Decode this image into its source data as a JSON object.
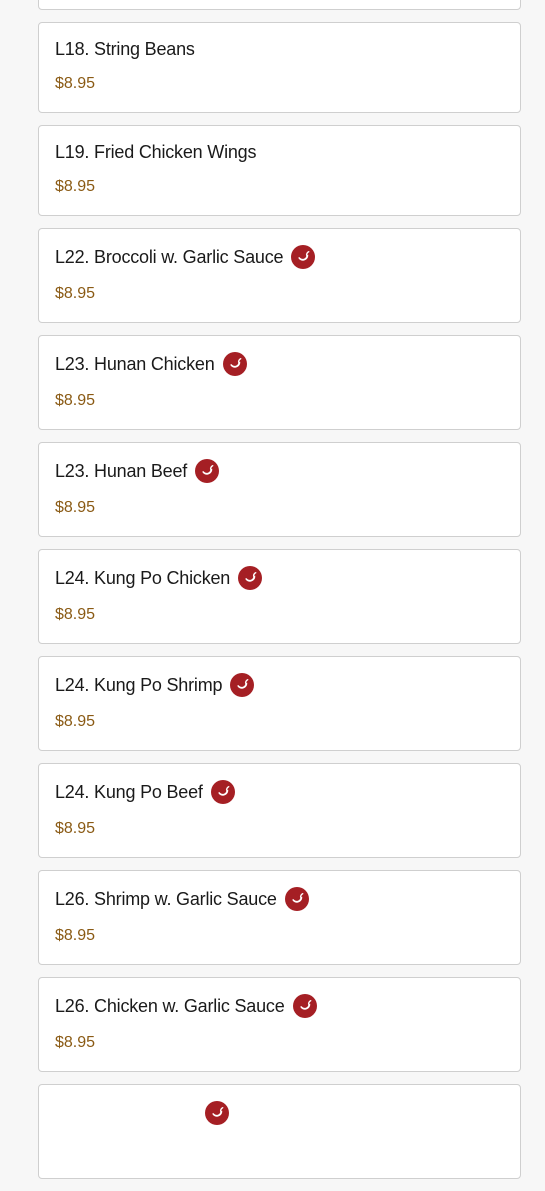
{
  "accent_color": "#a51f24",
  "price_color": "#8a5a14",
  "items": [
    {
      "name": "",
      "price": "",
      "spicy": false,
      "icon": ""
    },
    {
      "name": "L18. String Beans",
      "price": "$8.95",
      "spicy": false,
      "icon": ""
    },
    {
      "name": "L19. Fried Chicken Wings",
      "price": "$8.95",
      "spicy": false,
      "icon": ""
    },
    {
      "name": "L22. Broccoli w. Garlic Sauce",
      "price": "$8.95",
      "spicy": true,
      "icon": "chili-pepper-icon"
    },
    {
      "name": "L23. Hunan Chicken",
      "price": "$8.95",
      "spicy": true,
      "icon": "chili-pepper-icon"
    },
    {
      "name": "L23. Hunan Beef",
      "price": "$8.95",
      "spicy": true,
      "icon": "chili-pepper-icon"
    },
    {
      "name": "L24. Kung Po Chicken",
      "price": "$8.95",
      "spicy": true,
      "icon": "chili-pepper-icon"
    },
    {
      "name": "L24. Kung Po Shrimp",
      "price": "$8.95",
      "spicy": true,
      "icon": "chili-pepper-icon"
    },
    {
      "name": "L24. Kung Po Beef",
      "price": "$8.95",
      "spicy": true,
      "icon": "chili-pepper-icon"
    },
    {
      "name": "L26. Shrimp w. Garlic Sauce",
      "price": "$8.95",
      "spicy": true,
      "icon": "chili-pepper-icon"
    },
    {
      "name": "L26. Chicken w. Garlic Sauce",
      "price": "$8.95",
      "spicy": true,
      "icon": "chili-pepper-icon"
    },
    {
      "name": "",
      "price": "",
      "spicy": true,
      "icon": "chili-pepper-icon"
    }
  ]
}
